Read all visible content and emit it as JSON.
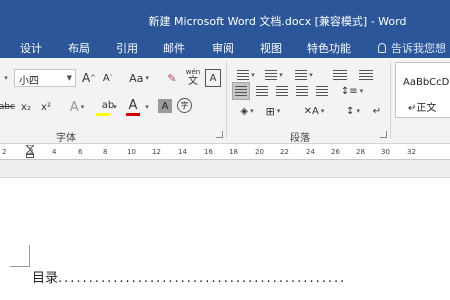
{
  "window": {
    "title": "新建 Microsoft Word 文档.docx [兼容模式] - Word"
  },
  "ribbon_tabs": [
    "设计",
    "布局",
    "引用",
    "邮件",
    "审阅",
    "视图",
    "特色功能"
  ],
  "tell_me": "告诉我您想",
  "font": {
    "size_value": "小四",
    "grow_label": "A",
    "shrink_label": "A",
    "case_label": "Aa",
    "wen_label": "wén",
    "wen_char": "文",
    "boxed_a": "A",
    "strike_label": "abc",
    "subscript_label": "x₂",
    "superscript_label": "x²",
    "effects_label": "A",
    "highlight_label": "ab",
    "font_color_label": "A",
    "shading_label": "A",
    "enclose_label": "字",
    "group_label": "字体"
  },
  "paragraph": {
    "group_label": "段落",
    "asian_label": "A"
  },
  "styles": {
    "sample_label": "AaBbCcD",
    "normal_label": "↵正文"
  },
  "ruler": {
    "numbers": [
      "2",
      "2",
      "4",
      "6",
      "8",
      "10",
      "12",
      "14",
      "16",
      "18",
      "20",
      "22",
      "24",
      "26",
      "28",
      "30",
      "32"
    ]
  },
  "document": {
    "toc_label": "目录",
    "toc_dots": "..............................................."
  },
  "colors": {
    "titlebar": "#2b579a",
    "ribbon": "#f3f3f3",
    "highlight_yellow": "#ffff00",
    "font_red": "#d00000"
  }
}
